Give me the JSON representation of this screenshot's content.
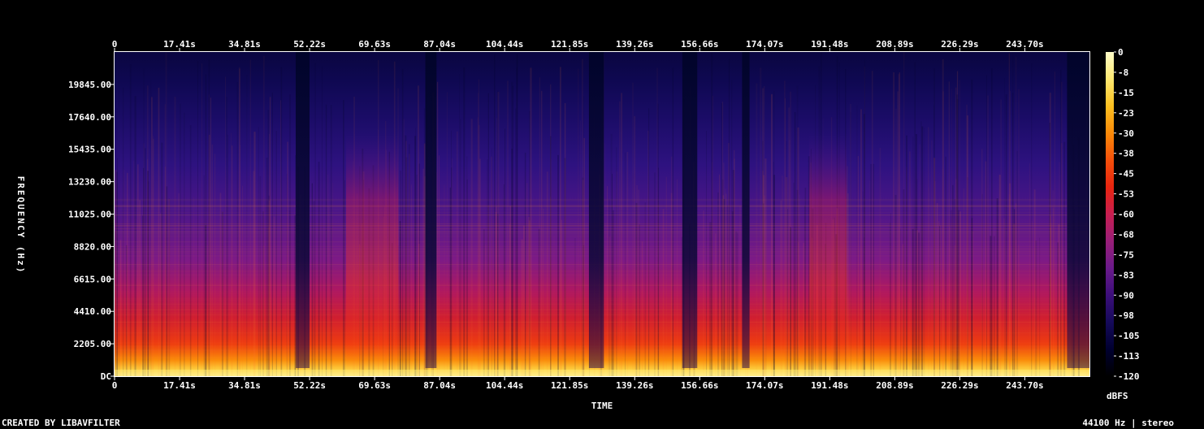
{
  "chart_data": {
    "type": "heatmap",
    "title": "",
    "xlabel": "TIME",
    "ylabel": "FREQUENCY (Hz)",
    "x_ticks": [
      "0",
      "17.41s",
      "34.81s",
      "52.22s",
      "69.63s",
      "87.04s",
      "104.44s",
      "121.85s",
      "139.26s",
      "156.66s",
      "174.07s",
      "191.48s",
      "208.89s",
      "226.29s",
      "243.70s"
    ],
    "x_tick_values": [
      0,
      17.41,
      34.81,
      52.22,
      69.63,
      87.04,
      104.44,
      121.85,
      139.26,
      156.66,
      174.07,
      191.48,
      208.89,
      226.29,
      243.7
    ],
    "xlim": [
      0,
      261
    ],
    "y_ticks": [
      "DC",
      "2205.00",
      "4410.00",
      "6615.00",
      "8820.00",
      "11025.00",
      "13230.00",
      "15435.00",
      "17640.00",
      "19845.00"
    ],
    "y_tick_values": [
      0,
      2205,
      4410,
      6615,
      8820,
      11025,
      13230,
      15435,
      17640,
      19845
    ],
    "ylim": [
      0,
      22050
    ],
    "colorbar": {
      "label": "dBFS",
      "ticks": [
        "0",
        "-8",
        "-15",
        "-23",
        "-30",
        "-38",
        "-45",
        "-53",
        "-60",
        "-68",
        "-75",
        "-83",
        "-90",
        "-98",
        "-105",
        "-113",
        "-120"
      ],
      "range": [
        -120,
        0
      ],
      "colors": [
        "#000000",
        "#000030",
        "#150a5a",
        "#3c0e7a",
        "#6a1a8a",
        "#991e78",
        "#c81e50",
        "#e8240f",
        "#f5500a",
        "#fa8a08",
        "#fcc020",
        "#fde870",
        "#fffcc8"
      ]
    },
    "quiet_segments_s": [
      [
        48.5,
        52.2
      ],
      [
        83.2,
        86.2
      ],
      [
        127.0,
        131.0
      ],
      [
        152.0,
        156.0
      ],
      [
        168.0,
        170.0
      ],
      [
        255.0,
        261.0
      ]
    ],
    "loud_segments_s": [
      [
        62.0,
        76.0
      ],
      [
        186.0,
        196.0
      ]
    ]
  },
  "footer": {
    "credit": "CREATED BY LIBAVFILTER",
    "sample_rate": "44100 Hz | stereo"
  }
}
